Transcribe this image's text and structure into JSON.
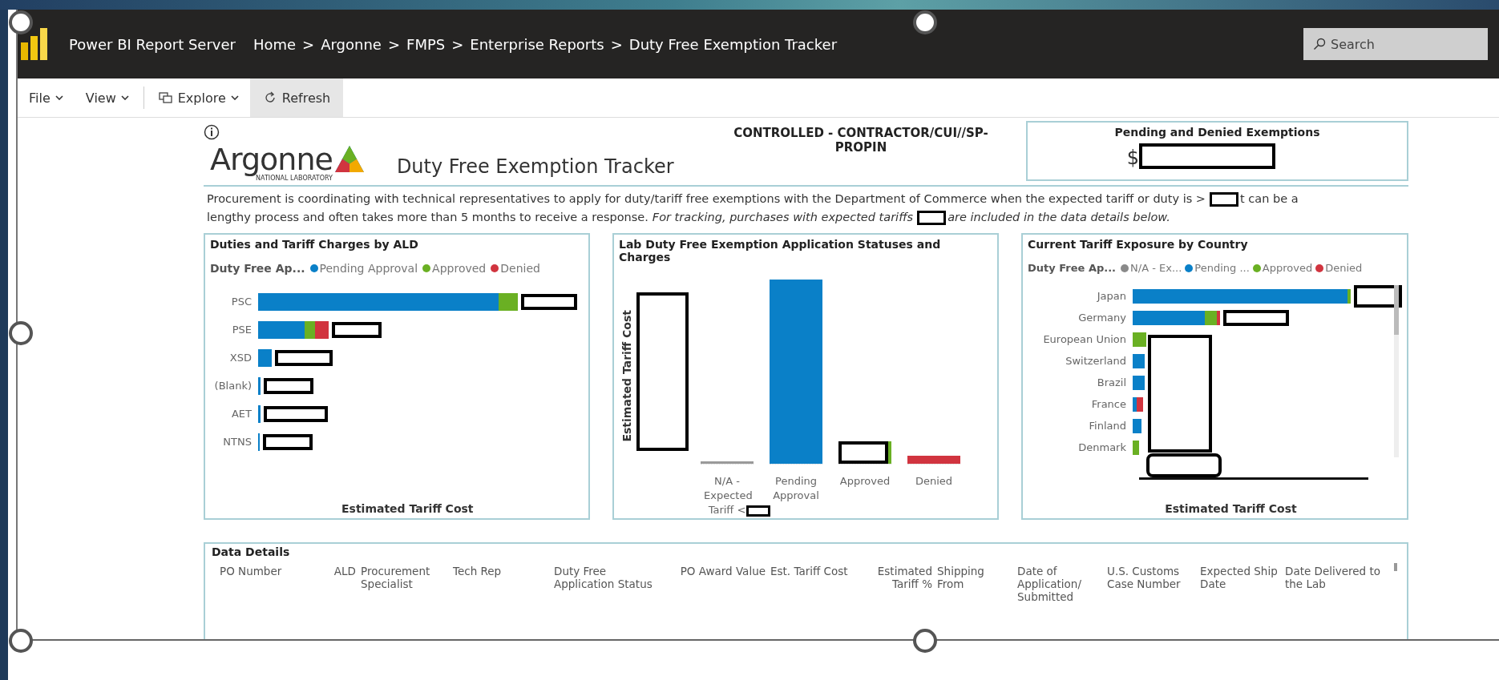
{
  "topbar": {
    "app_name": "Power BI Report Server",
    "breadcrumb": [
      {
        "label": "Home"
      },
      {
        "separator": ">",
        "label": "Argonne"
      },
      {
        "separator": ">",
        "label": "FMPS"
      },
      {
        "separator": ">",
        "label": "Enterprise Reports"
      },
      {
        "separator": ">",
        "label": "Duty Free Exemption Tracker"
      }
    ],
    "search": {
      "placeholder": "Search"
    }
  },
  "toolbar": [
    {
      "label": "File",
      "kind": "menu",
      "selected": false
    },
    {
      "label": "View",
      "kind": "menu",
      "selected": false
    },
    {
      "label": "Explore",
      "kind": "explore",
      "selected": false
    },
    {
      "label": "Refresh",
      "kind": "refresh",
      "selected": true
    }
  ],
  "report": {
    "logo": {
      "name": "Argonne",
      "subtitle": "NATIONAL LABORATORY"
    },
    "title": "Duty Free Exemption Tracker",
    "classification": "CONTROLLED - CONTRACTOR/CUI//SP-PROPIN",
    "kpi_card": {
      "title": "Pending and Denied Exemptions",
      "value_prefix": "$",
      "redacted": true
    },
    "description": [
      [
        {
          "kind": "text",
          "text": "Procurement is coordinating with technical representatives to apply for duty/tariff free exemptions with the Department of Commerce when the expected tariff or duty is >"
        },
        {
          "kind": "redacted"
        },
        {
          "kind": "text",
          "text": "t can be a"
        }
      ],
      [
        {
          "kind": "text",
          "text": "lengthy process and often takes more than 5 months to receive a response."
        },
        {
          "kind": "italic",
          "text": "For tracking, purchases with expected tariffs"
        },
        {
          "kind": "redacted"
        },
        {
          "kind": "italic",
          "text": "are included in the data details below."
        }
      ]
    ]
  },
  "charts": [
    {
      "kind": "hbar",
      "title": "Duties and Tariff Charges by ALD",
      "legend": {
        "title": "Duty Free Ap...",
        "items": [
          {
            "label": "Pending Approval",
            "color": "#0a80c8"
          },
          {
            "label": "Approved",
            "color": "#6ab023"
          },
          {
            "label": "Denied",
            "color": "#d1343f"
          }
        ]
      },
      "categories": [
        {
          "label": "PSC",
          "redacted": true
        },
        {
          "label": "PSE",
          "redacted": true
        },
        {
          "label": "XSD",
          "redacted": true
        },
        {
          "label": "(Blank)",
          "redacted": true
        },
        {
          "label": "AET",
          "redacted": true
        },
        {
          "label": "NTNS",
          "redacted": true
        }
      ],
      "xlabel": "Estimated Tariff Cost"
    },
    {
      "kind": "column",
      "title": "Lab Duty Free Exemption Application Statuses and Charges",
      "ylabel": "Estimated Tariff Cost",
      "ylabel_redacted": true,
      "categories": [
        {
          "label": "N/A - Expected Tariff <",
          "color": "#9a9a9a",
          "redacted": true,
          "bar_redacted": false
        },
        {
          "label": "Pending Approval",
          "color": "#0a80c8",
          "redacted": false,
          "bar_redacted": false
        },
        {
          "label": "Approved",
          "color": "#6ab023",
          "redacted": false,
          "bar_redacted": true
        },
        {
          "label": "Denied",
          "color": "#d1343f",
          "redacted": false,
          "bar_redacted": false
        }
      ]
    },
    {
      "kind": "hbar",
      "title": "Current Tariff Exposure by Country",
      "legend": {
        "title": "Duty Free Ap...",
        "items": [
          {
            "label": "N/A - Ex...",
            "color": "#8a8a8a"
          },
          {
            "label": "Pending ...",
            "color": "#0a80c8"
          },
          {
            "label": "Approved",
            "color": "#6ab023"
          },
          {
            "label": "Denied",
            "color": "#d1343f"
          }
        ]
      },
      "categories": [
        {
          "label": "Japan",
          "redacted": true
        },
        {
          "label": "Germany",
          "redacted": true
        },
        {
          "label": "European Union",
          "redacted": false
        },
        {
          "label": "Switzerland",
          "redacted": false
        },
        {
          "label": "Brazil",
          "redacted": false
        },
        {
          "label": "France",
          "redacted": false
        },
        {
          "label": "Finland",
          "redacted": false
        },
        {
          "label": "Denmark",
          "redacted": false
        }
      ],
      "block_redacted": true,
      "xlabel": "Estimated Tariff Cost"
    }
  ],
  "data_details": {
    "title": "Data Details",
    "columns": [
      "PO Number",
      "ALD",
      "Procurement Specialist",
      "Tech Rep",
      "Duty Free Application Status",
      "PO Award Value",
      "Est. Tariff Cost",
      "Estimated Tariff %",
      "Shipping From",
      "Date of Application/ Submitted",
      "U.S. Customs Case Number",
      "Expected Ship Date",
      "Date Delivered to the Lab"
    ]
  }
}
